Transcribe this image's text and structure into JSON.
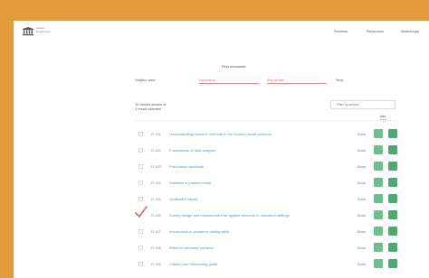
{
  "header": {
    "logo_lines": [
      "Library",
      "Department"
    ],
    "nav": [
      "Reviews",
      "Resources",
      "Workshops"
    ]
  },
  "search": {
    "title": "Find resources",
    "label_left": "Subject area",
    "input_1": "Keywords",
    "input_2": "Any author",
    "label_right": "Year"
  },
  "results": {
    "count_lines": [
      "10 results shown of",
      "1 result selected"
    ],
    "filter_placeholder": "Filter by subject",
    "column_header_lines": [
      "Add",
      "copy"
    ]
  },
  "rows": [
    {
      "id": "R-101",
      "title": "Understanding research methods in the modern social sciences",
      "kind": "Book",
      "selected": false,
      "title_width": 128
    },
    {
      "id": "R-102",
      "title": "Foundations of data analysis",
      "kind": "Book",
      "selected": false,
      "title_width": 66
    },
    {
      "id": "R-103",
      "title": "Field study handbook",
      "kind": "Book",
      "selected": false,
      "title_width": 46
    },
    {
      "id": "R-104",
      "title": "Statistics in practice today",
      "kind": "Book",
      "selected": false,
      "title_width": 54
    },
    {
      "id": "R-105",
      "title": "Qualitative inquiry",
      "kind": "Book",
      "selected": false,
      "title_width": 40
    },
    {
      "id": "R-106",
      "title": "Survey design and measurement for applied research in education settings",
      "kind": "Book",
      "selected": true,
      "title_width": 148
    },
    {
      "id": "R-107",
      "title": "Introduction to academic writing skills",
      "kind": "Book",
      "selected": false,
      "title_width": 84
    },
    {
      "id": "R-108",
      "title": "Ethics in scholarly research",
      "kind": "Book",
      "selected": false,
      "title_width": 68
    },
    {
      "id": "R-109",
      "title": "Citation and referencing guide",
      "kind": "Book",
      "selected": false,
      "title_width": 64
    }
  ],
  "colors": {
    "frame_border": "#e39a3d",
    "link": "#5a8fc8",
    "btn_light": "#6fbf8e",
    "btn_dark": "#4fa86f",
    "check_mark": "#d86a6a"
  }
}
